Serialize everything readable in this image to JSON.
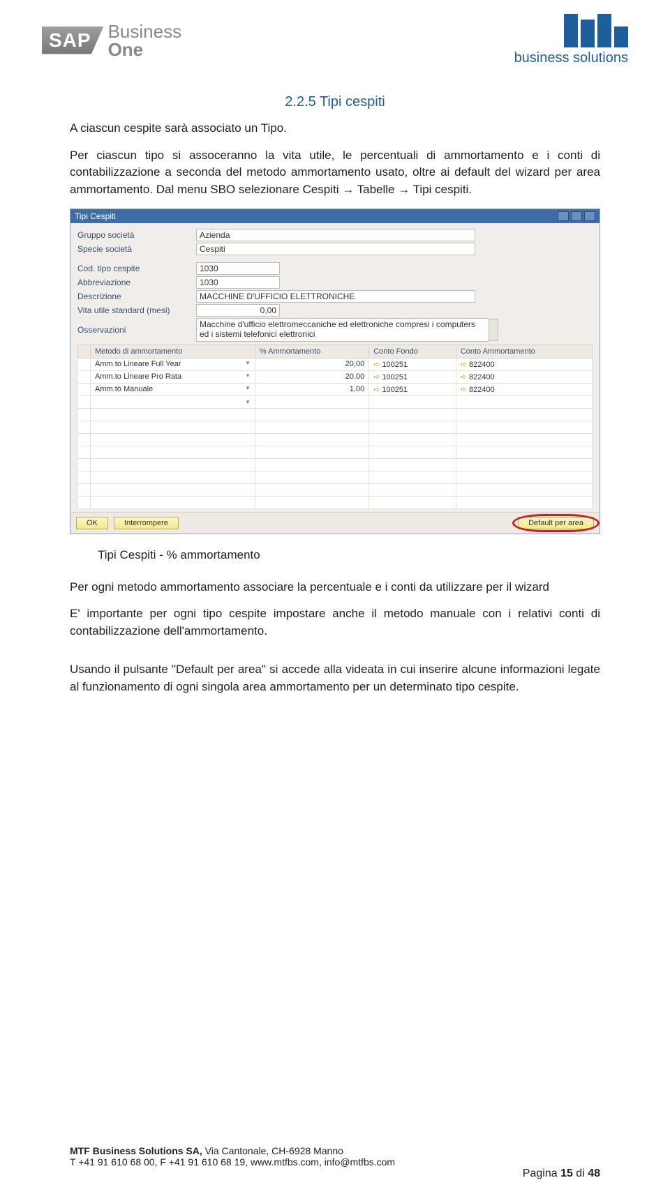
{
  "header": {
    "sap_badge": "SAP",
    "sap_line1": "Business",
    "sap_line2": "One",
    "mtf_line": "business solutions"
  },
  "doc": {
    "section_title": "2.2.5 Tipi cespiti",
    "p1": "A ciascun cespite sarà associato un Tipo.",
    "p2": "Per ciascun tipo si assoceranno la vita utile, le percentuali di ammortamento e i conti di contabilizzazione a seconda del metodo ammortamento usato, oltre ai default del wizard per area ammortamento. Dal menu SBO selezionare Cespiti → Tabelle → Tipi cespiti.",
    "caption": "Tipi Cespiti - % ammortamento",
    "p3": "Per ogni metodo ammortamento associare la percentuale e i conti da utilizzare per il wizard",
    "p4": "E' importante per ogni tipo cespite impostare anche il metodo manuale con i relativi conti di contabilizzazione dell'ammortamento.",
    "p5": "Usando il pulsante \"Default per area\" si accede alla videata in cui inserire alcune informazioni legate al funzionamento di ogni singola area ammortamento per un determinato tipo cespite."
  },
  "win": {
    "title": "Tipi Cespiti",
    "labels": {
      "gruppo": "Gruppo società",
      "specie": "Specie società",
      "cod": "Cod. tipo cespite",
      "abbrev": "Abbreviazione",
      "descr": "Descrizione",
      "vita": "Vita utile standard (mesi)",
      "oss": "Osservazioni"
    },
    "values": {
      "gruppo": "Azienda",
      "specie": "Cespiti",
      "cod": "1030",
      "abbrev": "1030",
      "descr": "MACCHINE D'UFFICIO ELETTRONICHE",
      "vita": "0,00",
      "oss": "Macchine d'ufficio elettromeccaniche ed elettroniche compresi i computers ed i sistemi telefonici elettronici"
    },
    "table": {
      "headers": [
        "Metodo di ammortamento",
        "% Ammortamento",
        "Conto Fondo",
        "Conto Ammortamento"
      ],
      "rows": [
        {
          "metodo": "Amm.to Lineare Full Year",
          "pct": "20,00",
          "fondo": "100251",
          "conto": "822400"
        },
        {
          "metodo": "Amm.to Lineare Pro Rata",
          "pct": "20,00",
          "fondo": "100251",
          "conto": "822400"
        },
        {
          "metodo": "Amm.to Manuale",
          "pct": "1,00",
          "fondo": "100251",
          "conto": "822400"
        }
      ]
    },
    "buttons": {
      "ok": "OK",
      "cancel": "Interrompere",
      "default": "Default per area"
    }
  },
  "footer": {
    "company": "MTF Business Solutions SA, ",
    "address": "Via Cantonale, CH-6928 Manno",
    "contact": "T +41 91 610 68 00, F +41 91 610 68 19, www.mtfbs.com, info@mtfbs.com",
    "page_prefix": "Pagina ",
    "page_num": "15",
    "page_of": " di ",
    "page_total": "48"
  }
}
